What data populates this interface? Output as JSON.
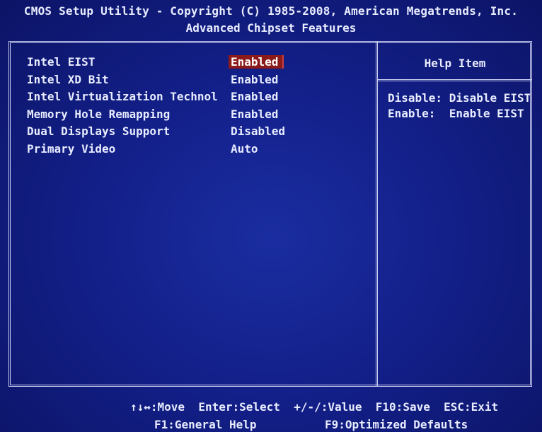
{
  "header": {
    "title_line": "CMOS Setup Utility - Copyright (C) 1985-2008, American Megatrends, Inc.",
    "subtitle": "Advanced Chipset Features"
  },
  "settings": [
    {
      "label": "Intel EIST",
      "value": "Enabled",
      "selected": true
    },
    {
      "label": "Intel XD Bit",
      "value": "Enabled",
      "selected": false
    },
    {
      "label": "Intel Virtualization Technol",
      "value": "Enabled",
      "selected": false
    },
    {
      "label": "Memory Hole Remapping",
      "value": "Enabled",
      "selected": false
    },
    {
      "label": "Dual Displays Support",
      "value": "Disabled",
      "selected": false
    },
    {
      "label": "Primary Video",
      "value": "Auto",
      "selected": false
    }
  ],
  "help": {
    "title": "Help Item",
    "lines": [
      "Disable: Disable EIST",
      "Enable:  Enable EIST"
    ]
  },
  "footer": {
    "line1": "↑↓↔:Move  Enter:Select  +/-/:Value  F10:Save  ESC:Exit",
    "line2_left": "F1:General Help",
    "line2_right": "F9:Optimized Defaults"
  },
  "colors": {
    "background": "#13208a",
    "text": "#e8ecff",
    "highlight": "#8b1a1a",
    "border": "#c8ccf0"
  }
}
